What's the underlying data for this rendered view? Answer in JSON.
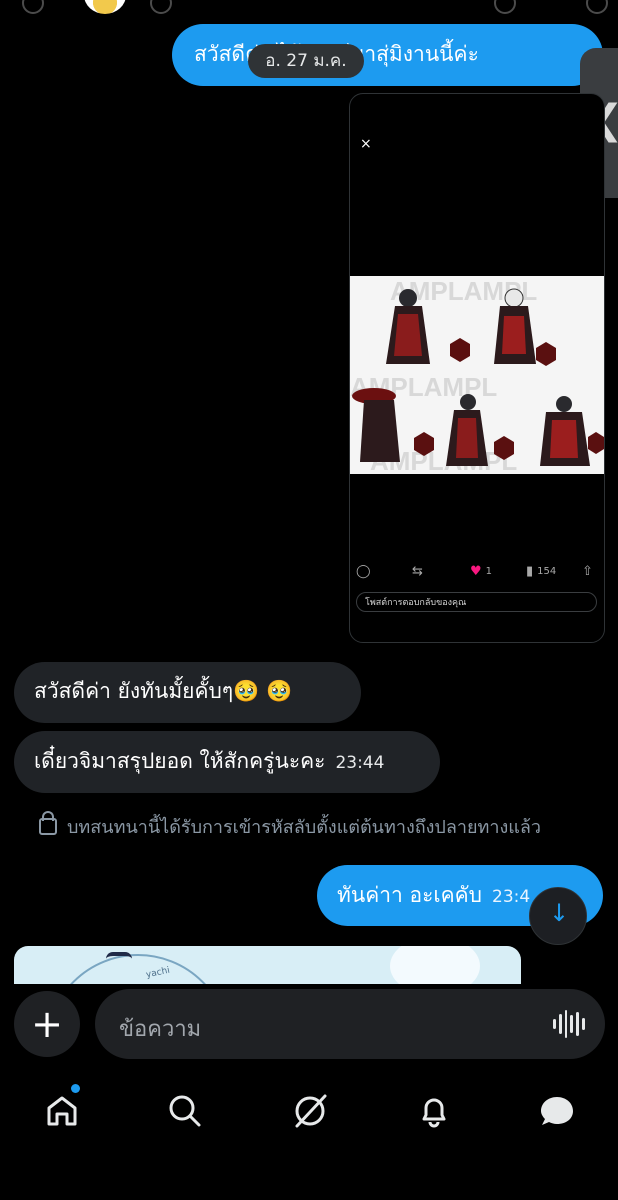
{
  "chat": {
    "out_message_1": "สวัสดีค่ะ ได้จำพรีมาสุ่มิงานนี้ค่ะ",
    "date_separator": "อ. 27 ม.ค.",
    "in_message_1": "สวัสดีค่า ยังทันมั้ยคั้บๆ🥹 🥹",
    "in_message_2_text": "เดี๋ยวจิมาสรุปยอด ให้สักครู่นะคะ",
    "in_message_2_time": "23:44",
    "encryption_notice": "บทสนทนานี้ได้รับการเข้ารหัสลับตั้งแต่ต้นทางถึงปลายทางแล้ว",
    "out_message_2_text": "ทันค่าา อะเคคับ",
    "out_message_2_time": "23:4"
  },
  "post_card": {
    "close_icon": "×",
    "watermark": "AMPLAMPL",
    "likes": "1",
    "views": "154",
    "reply_placeholder": "โพสต์การตอบกลับของคุณ"
  },
  "preview_image": {
    "caption": "yachi"
  },
  "composer": {
    "placeholder": "ข้อความ",
    "plus_icon": "+"
  },
  "nav": {
    "items": [
      "home-icon",
      "search-icon",
      "grok-icon",
      "notifications-icon",
      "messages-icon"
    ]
  },
  "colors": {
    "accent": "#1d9bf0",
    "background": "#000000",
    "incoming_bubble": "#202327",
    "heart": "#f91880"
  }
}
